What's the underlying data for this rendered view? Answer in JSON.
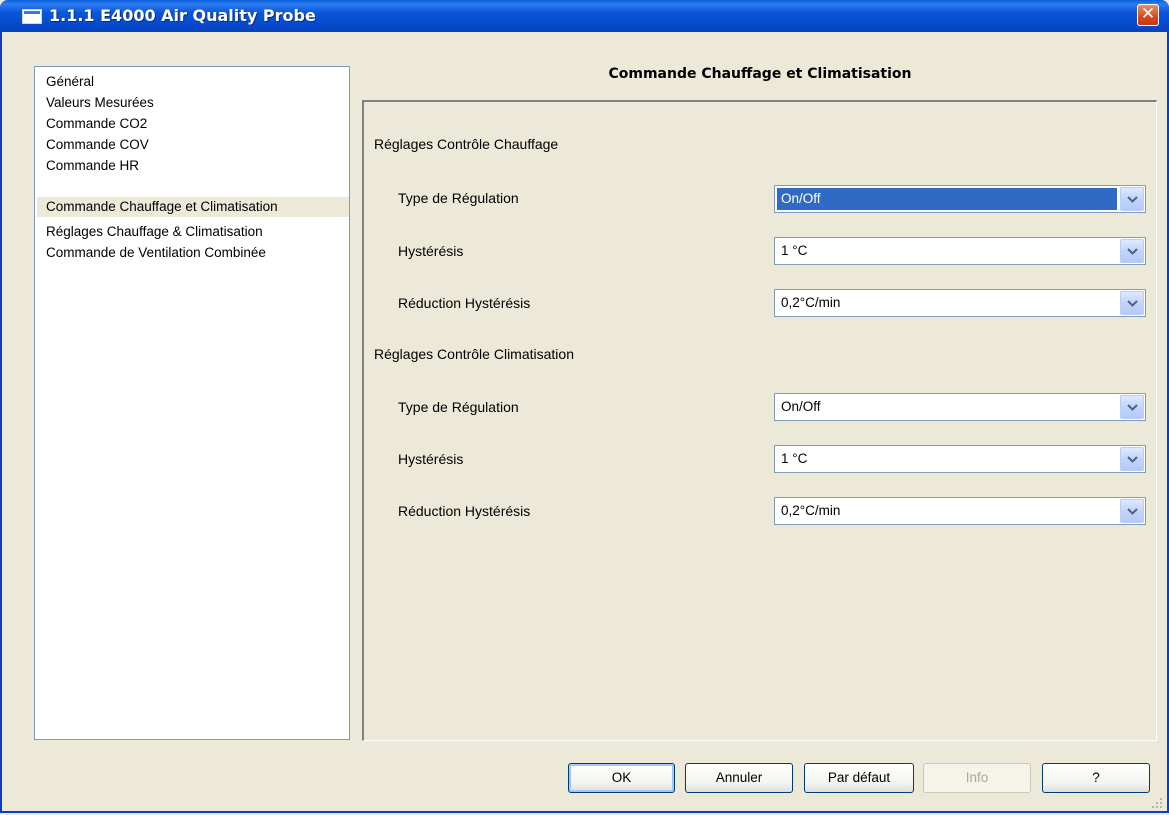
{
  "window": {
    "title": "1.1.1 E4000 Air Quality Probe",
    "close_glyph": "✕"
  },
  "nav": {
    "items": [
      "Général",
      "Valeurs Mesurées",
      "Commande CO2",
      "Commande COV",
      "Commande HR",
      "Commande Chauffage et Climatisation",
      "Réglages Chauffage & Climatisation",
      "Commande de Ventilation Combinée"
    ],
    "selected_index": 5
  },
  "section_title": "Commande Chauffage et Climatisation",
  "heating": {
    "group_label": "Réglages Contrôle Chauffage",
    "fields": [
      {
        "label": "Type de Régulation",
        "value": "On/Off"
      },
      {
        "label": "Hystérésis",
        "value": "1 °C"
      },
      {
        "label": "Réduction Hystérésis",
        "value": "0,2°C/min"
      }
    ]
  },
  "cooling": {
    "group_label": "Réglages Contrôle Climatisation",
    "fields": [
      {
        "label": "Type de Régulation",
        "value": "On/Off"
      },
      {
        "label": "Hystérésis",
        "value": "1 °C"
      },
      {
        "label": "Réduction Hystérésis",
        "value": "0,2°C/min"
      }
    ]
  },
  "buttons": {
    "ok": "OK",
    "cancel": "Annuler",
    "default": "Par défaut",
    "info": "Info",
    "help": "?"
  },
  "colors": {
    "titlebar": "#0549CC",
    "selection": "#316AC5",
    "background": "#ECE9D8",
    "close": "#D5491C"
  }
}
